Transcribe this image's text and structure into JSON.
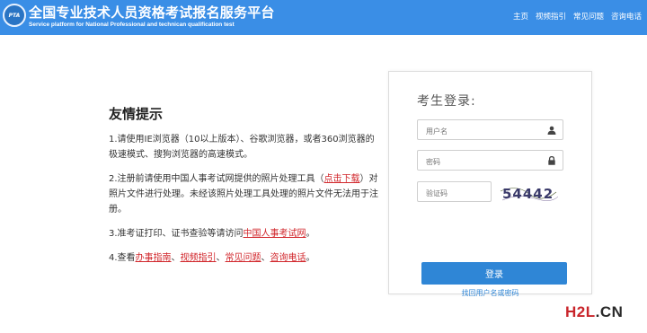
{
  "header": {
    "logo_text": "PTA",
    "title": "全国专业技术人员资格考试报名服务平台",
    "subtitle": "Service platform for National Professional and technican qualification test",
    "nav": [
      "主页",
      "视频指引",
      "常见问题",
      "咨询电话"
    ]
  },
  "tips": {
    "title": "友情提示",
    "p1": "1.请使用IE浏览器（10以上版本）、谷歌浏览器，或者360浏览器的极速模式、搜狗浏览器的高速模式。",
    "p2_before": "2.注册前请使用中国人事考试网提供的照片处理工具（",
    "p2_link": "点击下载",
    "p2_after": "）对照片文件进行处理。未经该照片处理工具处理的照片文件无法用于注册。",
    "p3_before": "3.准考证打印、证书查验等请访问",
    "p3_link": "中国人事考试网",
    "p3_after": "。",
    "p4_before": "4.查看",
    "p4_links": [
      "办事指南",
      "视频指引",
      "常见问题",
      "咨询电话"
    ],
    "p4_sep": "、",
    "p4_after": "。"
  },
  "login": {
    "title": "考生登录:",
    "username_placeholder": "用户名",
    "password_placeholder": "密码",
    "captcha_placeholder": "验证码",
    "captcha_text": "54442",
    "submit_label": "登录",
    "forgot_label": "找回用户名或密码"
  },
  "watermark": {
    "part_a": "H2L",
    "part_b": ".CN"
  },
  "colors": {
    "header_bg": "#3a8ee6",
    "link_red": "#d1262b",
    "button_blue": "#2f86d6"
  }
}
